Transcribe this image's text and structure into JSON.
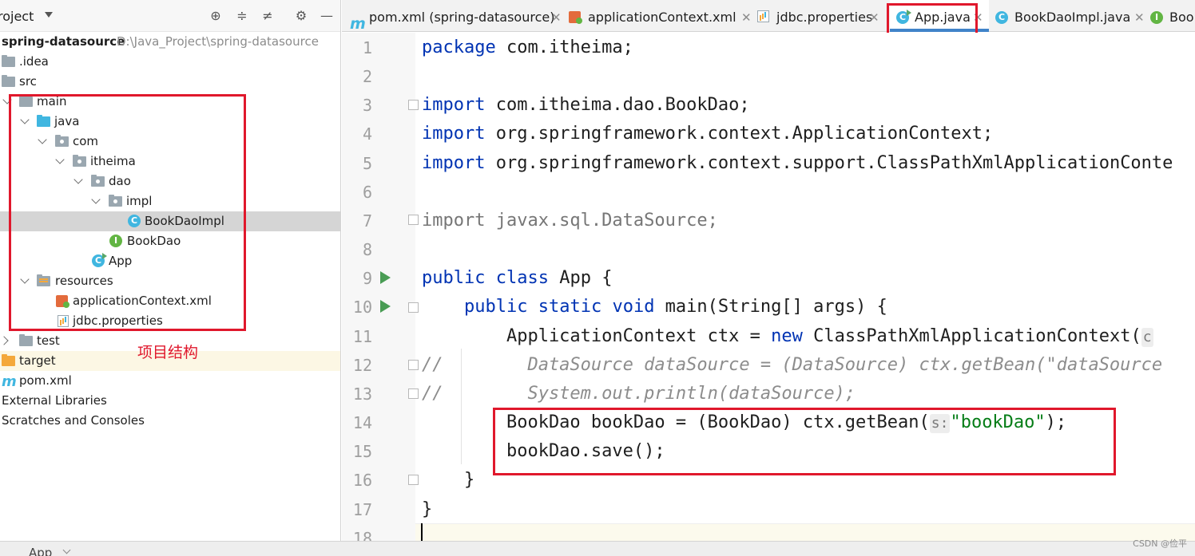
{
  "project_panel": {
    "title": "roject",
    "header_icons": [
      "crosshair-icon",
      "expand-all-icon",
      "collapse-all-icon",
      "gear-icon",
      "minimize-icon"
    ],
    "tree": [
      {
        "label": "spring-datasource",
        "path": "D:\\Java_Project\\spring-datasource",
        "icon": "module-folder-icon"
      },
      {
        "label": ".idea",
        "icon": "folder-icon"
      },
      {
        "label": "src",
        "icon": "folder-icon"
      },
      {
        "label": "main",
        "icon": "folder-icon",
        "expanded": true
      },
      {
        "label": "java",
        "icon": "source-folder-icon",
        "expanded": true
      },
      {
        "label": "com",
        "icon": "package-icon",
        "expanded": true
      },
      {
        "label": "itheima",
        "icon": "package-icon",
        "expanded": true
      },
      {
        "label": "dao",
        "icon": "package-icon",
        "expanded": true
      },
      {
        "label": "impl",
        "icon": "package-icon",
        "expanded": true
      },
      {
        "label": "BookDaoImpl",
        "icon": "class-icon",
        "selected": true
      },
      {
        "label": "BookDao",
        "icon": "interface-icon"
      },
      {
        "label": "App",
        "icon": "runnable-class-icon"
      },
      {
        "label": "resources",
        "icon": "resources-folder-icon",
        "expanded": true
      },
      {
        "label": "applicationContext.xml",
        "icon": "spring-xml-icon"
      },
      {
        "label": "jdbc.properties",
        "icon": "properties-file-icon"
      },
      {
        "label": "test",
        "icon": "folder-icon",
        "expanded": false
      },
      {
        "label": "target",
        "icon": "excluded-folder-icon"
      },
      {
        "label": "pom.xml",
        "icon": "maven-icon"
      },
      {
        "label": "External Libraries",
        "icon": "library-icon"
      },
      {
        "label": "Scratches and Consoles",
        "icon": "scratch-icon"
      }
    ],
    "annotation": "项目结构"
  },
  "editor_tabs": [
    {
      "label": "pom.xml (spring-datasource)",
      "icon": "maven-icon",
      "active": false
    },
    {
      "label": "applicationContext.xml",
      "icon": "spring-xml-icon",
      "active": false
    },
    {
      "label": "jdbc.properties",
      "icon": "properties-file-icon",
      "active": false
    },
    {
      "label": "App.java",
      "icon": "runnable-class-icon",
      "active": true
    },
    {
      "label": "BookDaoImpl.java",
      "icon": "class-icon",
      "active": false
    },
    {
      "label": "Bool",
      "icon": "interface-icon",
      "active": false
    }
  ],
  "editor": {
    "line_numbers": [
      "1",
      "2",
      "3",
      "4",
      "5",
      "6",
      "7",
      "8",
      "9",
      "10",
      "11",
      "12",
      "13",
      "14",
      "15",
      "16",
      "17",
      "18"
    ],
    "lines": {
      "l1": {
        "kw": "package",
        "rest": " com.itheima;"
      },
      "l3": {
        "kw": "import",
        "rest": " com.itheima.dao.BookDao;"
      },
      "l4": {
        "kw": "import",
        "rest": " org.springframework.context.ApplicationContext;"
      },
      "l5": {
        "kw": "import",
        "rest": " org.springframework.context.support.ClassPathXmlApplicationConte"
      },
      "l7": {
        "text": "import javax.sql.DataSource;"
      },
      "l9": {
        "kw1": "public",
        "kw2": "class",
        "rest": " App {"
      },
      "l10": {
        "kw1": "public",
        "kw2": "static",
        "kw3": "void",
        "rest": " main(String[] args) {"
      },
      "l11": {
        "pre": "        ApplicationContext ctx = ",
        "kw": "new",
        "rest": " ClassPathXmlApplicationContext(",
        "hint": "c"
      },
      "l12": {
        "comment": "//        DataSource dataSource = (DataSource) ctx.getBean(\"dataSource"
      },
      "l13": {
        "comment": "//        System.out.println(dataSource);"
      },
      "l14": {
        "pre": "        BookDao bookDao = (BookDao) ctx.getBean(",
        "hint": "s:",
        "str": "\"bookDao\"",
        "post": ");"
      },
      "l15": {
        "text": "        bookDao.save();"
      },
      "l16": {
        "text": "    }"
      },
      "l17": {
        "text": "}"
      }
    }
  },
  "bottom_bar": {
    "run_tab": "App"
  },
  "watermark": "CSDN @俭平",
  "colors": {
    "annotation_red": "#e0182c",
    "keyword": "#0033b3",
    "string": "#067d17",
    "comment": "#8c8c8c",
    "active_tab": "#4083c9"
  }
}
